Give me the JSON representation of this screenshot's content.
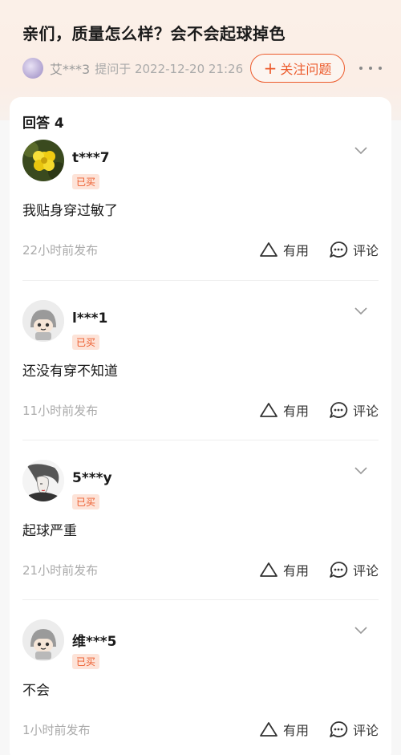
{
  "question": {
    "title": "亲们，质量怎么样？会不会起球掉色",
    "asker_name": "艾***3",
    "asker_meta": "提问于 2022-12-20 21:26",
    "follow_label": "关注问题"
  },
  "answers_header": {
    "label": "回答",
    "count": "4"
  },
  "answers": [
    {
      "username": "t***7",
      "badge": "已买",
      "content": "我贴身穿过敏了",
      "time": "22小时前发布",
      "avatar": "yellow-flower-avatar"
    },
    {
      "username": "l***1",
      "badge": "已买",
      "content": "还没有穿不知道",
      "time": "11小时前发布",
      "avatar": "default-mascot-avatar"
    },
    {
      "username": "5***y",
      "badge": "已买",
      "content": "起球严重",
      "time": "21小时前发布",
      "avatar": "sketch-portrait-avatar"
    },
    {
      "username": "维***5",
      "badge": "已买",
      "content": "不会",
      "time": "1小时前发布",
      "avatar": "default-mascot-avatar"
    }
  ],
  "actions": {
    "useful_label": "有用",
    "comment_label": "评论"
  },
  "colors": {
    "accent": "#ec5b2c",
    "badge_bg": "#fde3d8",
    "header_bg": "#fbf0e8"
  }
}
